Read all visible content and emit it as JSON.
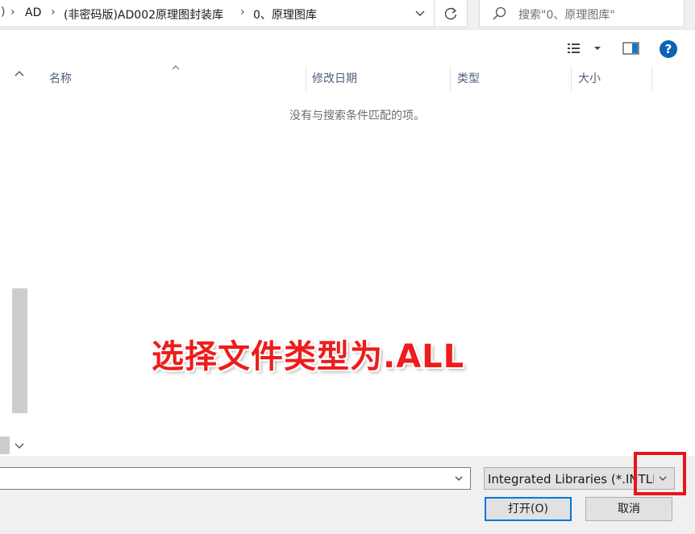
{
  "address_bar": {
    "breadcrumbs": [
      "AD",
      "(非密码版)AD002原理图封装库",
      "0、原理图库"
    ]
  },
  "search": {
    "placeholder": "搜索\"0、原理图库\""
  },
  "toolbar": {
    "help_label": "?"
  },
  "file_list": {
    "columns": [
      "名称",
      "修改日期",
      "类型",
      "大小"
    ],
    "empty_message": "没有与搜索条件匹配的项。"
  },
  "annotation": {
    "text": "选择文件类型为.ALL",
    "color": "#ee1c1c"
  },
  "filename": {
    "value": ""
  },
  "filetype": {
    "selected": "Integrated Libraries (*.INTLIB)"
  },
  "buttons": {
    "open_label": "打开(O)",
    "cancel_label": "取消"
  },
  "colors": {
    "accent": "#0078d7",
    "highlight_box": "#e8151b",
    "help_icon": "#0c63b3"
  }
}
